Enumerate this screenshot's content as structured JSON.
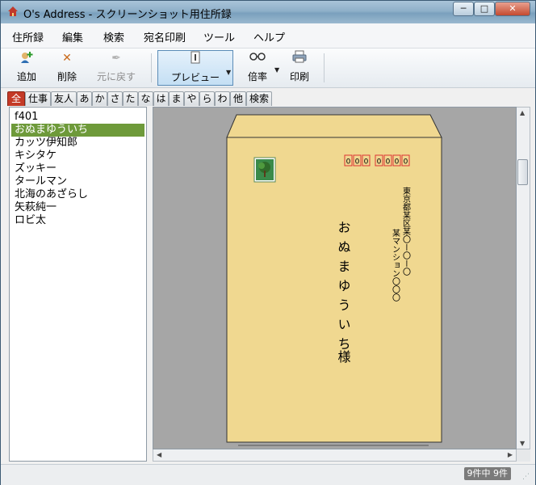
{
  "window": {
    "title": "O's Address - スクリーンショット用住所録"
  },
  "menu": [
    "住所録",
    "編集",
    "検索",
    "宛名印刷",
    "ツール",
    "ヘルプ"
  ],
  "toolbar": {
    "add": "追加",
    "delete": "削除",
    "undo": "元に戻す",
    "preview": "プレビュー",
    "zoom": "倍率",
    "print": "印刷"
  },
  "tabs": [
    "全",
    "仕事",
    "友人",
    "あ",
    "か",
    "さ",
    "た",
    "な",
    "は",
    "ま",
    "や",
    "ら",
    "わ",
    "他",
    "検索"
  ],
  "selected_tab": "全",
  "contacts": [
    "f401",
    "おぬまゆういち",
    "カッツ伊知郎",
    "キシタケ",
    "ズッキー",
    "タールマン",
    "北海のあざらし",
    "矢萩純一",
    "ロビ太"
  ],
  "selected_contact": "おぬまゆういち",
  "envelope": {
    "postal_code": [
      "0",
      "0",
      "0",
      "0",
      "0",
      "0",
      "0"
    ],
    "address_line1": "東京都某区某〇ー〇ー〇",
    "address_line2": "某マンション〇〇〇",
    "recipient_name": "おぬまゆういち",
    "honorific": "様",
    "envelope_color": "#f0d890",
    "stamp_color": "#3a8a4a"
  },
  "status": {
    "count": "9件中 9件"
  }
}
